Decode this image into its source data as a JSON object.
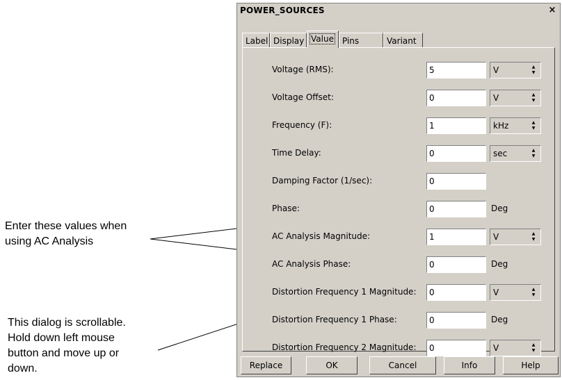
{
  "annotations": {
    "ac_note": [
      "Enter these values when",
      "using AC Analysis"
    ],
    "scroll_note": [
      "This dialog is scrollable.",
      "Hold down left mouse",
      "button and move up or",
      "down."
    ]
  },
  "dialog": {
    "title": "POWER_SOURCES",
    "close_glyph": "×",
    "tabs": [
      "Label",
      "Display",
      "Value",
      "Pins",
      "Variant"
    ],
    "active_tab": "Value",
    "fields": [
      {
        "label": "Voltage (RMS):",
        "value": "5",
        "unit": "V",
        "unit_type": "spin"
      },
      {
        "label": "Voltage Offset:",
        "value": "0",
        "unit": "V",
        "unit_type": "spin"
      },
      {
        "label": "Frequency (F):",
        "value": "1",
        "unit": "kHz",
        "unit_type": "spin"
      },
      {
        "label": "Time Delay:",
        "value": "0",
        "unit": "sec",
        "unit_type": "spin"
      },
      {
        "label": "Damping Factor (1/sec):",
        "value": "0",
        "unit": "",
        "unit_type": "none"
      },
      {
        "label": "Phase:",
        "value": "0",
        "unit": "Deg",
        "unit_type": "plain"
      },
      {
        "label": "AC Analysis Magnitude:",
        "value": "1",
        "unit": "V",
        "unit_type": "spin"
      },
      {
        "label": "AC Analysis Phase:",
        "value": "0",
        "unit": "Deg",
        "unit_type": "plain"
      },
      {
        "label": "Distortion Frequency 1 Magnitude:",
        "value": "0",
        "unit": "V",
        "unit_type": "spin"
      },
      {
        "label": "Distortion Frequency 1 Phase:",
        "value": "0",
        "unit": "Deg",
        "unit_type": "plain"
      },
      {
        "label": "Distortion Frequency 2 Magnitude:",
        "value": "0",
        "unit": "V",
        "unit_type": "spin"
      }
    ],
    "buttons": [
      "Replace",
      "OK",
      "Cancel",
      "Info",
      "Help"
    ]
  }
}
